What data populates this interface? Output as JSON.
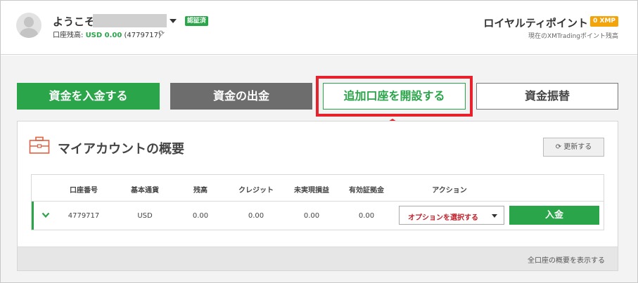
{
  "header": {
    "welcome": "ようこそ",
    "verified_badge": "認証済",
    "balance_label": "口座残高: ",
    "balance_value": "USD 0.00",
    "account_ref": " (4779717)",
    "loyalty_title": "ロイヤルティポイント",
    "xmp_badge": "0 XMP",
    "loyalty_sub": "現在のXMTradingポイント残高"
  },
  "actions": {
    "deposit": "資金を入金する",
    "withdraw": "資金の出金",
    "open_account": "追加口座を開設する",
    "transfer": "資金振替"
  },
  "overview": {
    "title": "マイアカウントの概要",
    "refresh": "更新する",
    "footer_link": "全口座の概要を表示する",
    "columns": [
      "口座番号",
      "基本通貨",
      "残高",
      "クレジット",
      "未実現損益",
      "有効証拠金",
      "アクション"
    ],
    "rows": [
      {
        "account": "4779717",
        "currency": "USD",
        "balance": "0.00",
        "credit": "0.00",
        "pnl": "0.00",
        "equity": "0.00",
        "option": "オプションを選択する",
        "deposit": "入金"
      }
    ]
  },
  "colors": {
    "brand_green": "#2aa54a",
    "highlight_red": "#e8222c",
    "badge_orange": "#f2a40a"
  }
}
